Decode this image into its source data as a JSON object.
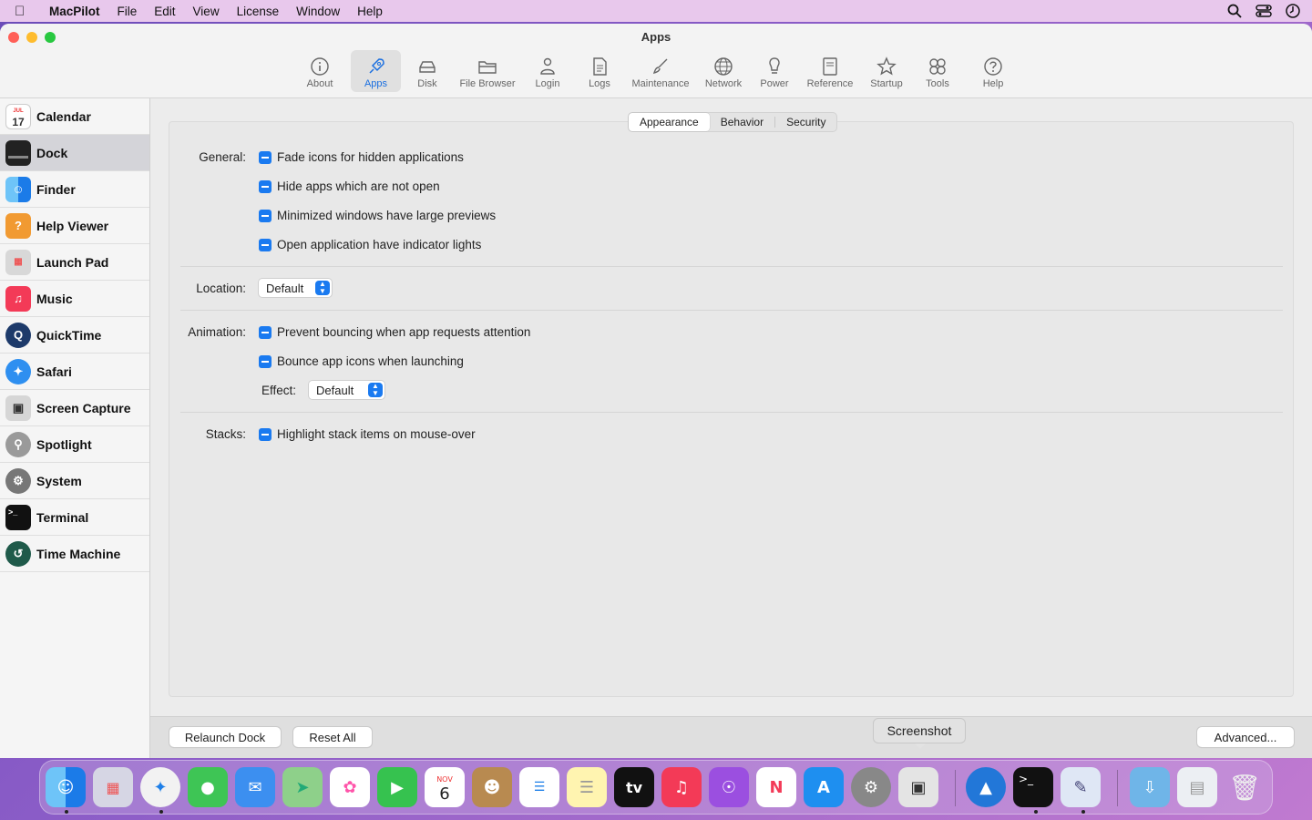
{
  "menubar": {
    "app_name": "MacPilot",
    "items": [
      "File",
      "Edit",
      "View",
      "License",
      "Window",
      "Help"
    ]
  },
  "window": {
    "title": "Apps"
  },
  "toolbar": {
    "items": [
      "About",
      "Apps",
      "Disk",
      "File Browser",
      "Login",
      "Logs",
      "Maintenance",
      "Network",
      "Power",
      "Reference",
      "Startup",
      "Tools",
      "Help"
    ],
    "active": "Apps"
  },
  "sidebar": {
    "items": [
      "Calendar",
      "Dock",
      "Finder",
      "Help Viewer",
      "Launch Pad",
      "Music",
      "QuickTime",
      "Safari",
      "Screen Capture",
      "Spotlight",
      "System",
      "Terminal",
      "Time Machine"
    ],
    "selected": "Dock",
    "calendar_icon": {
      "month": "JUL",
      "day": "17"
    }
  },
  "tabs": {
    "items": [
      "Appearance",
      "Behavior",
      "Security"
    ],
    "active": "Appearance"
  },
  "general": {
    "label": "General:",
    "options": [
      "Fade icons for hidden applications",
      "Hide apps which are not open",
      "Minimized windows have large previews",
      "Open application have indicator lights"
    ]
  },
  "location": {
    "label": "Location:",
    "value": "Default"
  },
  "animation": {
    "label": "Animation:",
    "options": [
      "Prevent bouncing when app requests attention",
      "Bounce app icons when launching"
    ],
    "effect_label": "Effect:",
    "effect_value": "Default"
  },
  "stacks": {
    "label": "Stacks:",
    "options": [
      "Highlight stack items on mouse-over"
    ]
  },
  "bottom": {
    "relaunch": "Relaunch Dock",
    "reset": "Reset All",
    "advanced": "Advanced..."
  },
  "tooltip": "Screenshot",
  "dock": {
    "calendar": {
      "month": "NOV",
      "day": "6"
    },
    "tv_label": "tv"
  },
  "colors": {
    "accent": "#1a7af0",
    "active_tool": "#1a6fe0"
  }
}
